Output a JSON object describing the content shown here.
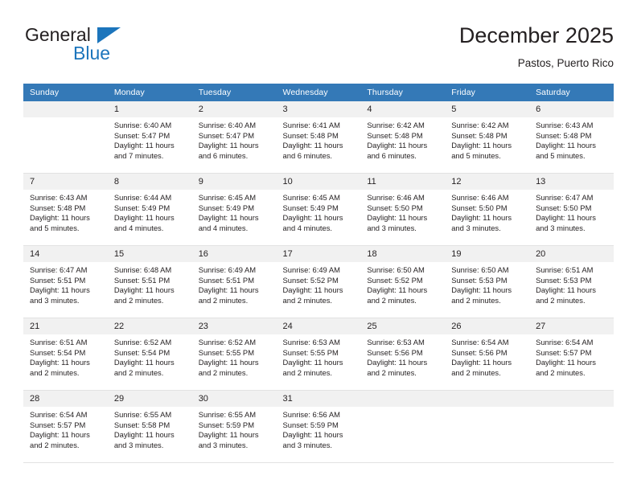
{
  "brand": {
    "name_top": "General",
    "name_bottom": "Blue",
    "accent_color": "#1c75bc"
  },
  "header": {
    "title": "December 2025",
    "subtitle": "Pastos, Puerto Rico"
  },
  "theme": {
    "header_bg": "#3479b7",
    "header_text": "#ffffff",
    "daynum_bg": "#f1f1f1",
    "cell_bg": "#ffffff",
    "grid_line": "#e2e2e2",
    "text": "#231f20"
  },
  "weekday_headers": [
    "Sunday",
    "Monday",
    "Tuesday",
    "Wednesday",
    "Thursday",
    "Friday",
    "Saturday"
  ],
  "weeks": [
    [
      {
        "day": "",
        "lines": []
      },
      {
        "day": "1",
        "lines": [
          "Sunrise: 6:40 AM",
          "Sunset: 5:47 PM",
          "Daylight: 11 hours",
          "and 7 minutes."
        ]
      },
      {
        "day": "2",
        "lines": [
          "Sunrise: 6:40 AM",
          "Sunset: 5:47 PM",
          "Daylight: 11 hours",
          "and 6 minutes."
        ]
      },
      {
        "day": "3",
        "lines": [
          "Sunrise: 6:41 AM",
          "Sunset: 5:48 PM",
          "Daylight: 11 hours",
          "and 6 minutes."
        ]
      },
      {
        "day": "4",
        "lines": [
          "Sunrise: 6:42 AM",
          "Sunset: 5:48 PM",
          "Daylight: 11 hours",
          "and 6 minutes."
        ]
      },
      {
        "day": "5",
        "lines": [
          "Sunrise: 6:42 AM",
          "Sunset: 5:48 PM",
          "Daylight: 11 hours",
          "and 5 minutes."
        ]
      },
      {
        "day": "6",
        "lines": [
          "Sunrise: 6:43 AM",
          "Sunset: 5:48 PM",
          "Daylight: 11 hours",
          "and 5 minutes."
        ]
      }
    ],
    [
      {
        "day": "7",
        "lines": [
          "Sunrise: 6:43 AM",
          "Sunset: 5:48 PM",
          "Daylight: 11 hours",
          "and 5 minutes."
        ]
      },
      {
        "day": "8",
        "lines": [
          "Sunrise: 6:44 AM",
          "Sunset: 5:49 PM",
          "Daylight: 11 hours",
          "and 4 minutes."
        ]
      },
      {
        "day": "9",
        "lines": [
          "Sunrise: 6:45 AM",
          "Sunset: 5:49 PM",
          "Daylight: 11 hours",
          "and 4 minutes."
        ]
      },
      {
        "day": "10",
        "lines": [
          "Sunrise: 6:45 AM",
          "Sunset: 5:49 PM",
          "Daylight: 11 hours",
          "and 4 minutes."
        ]
      },
      {
        "day": "11",
        "lines": [
          "Sunrise: 6:46 AM",
          "Sunset: 5:50 PM",
          "Daylight: 11 hours",
          "and 3 minutes."
        ]
      },
      {
        "day": "12",
        "lines": [
          "Sunrise: 6:46 AM",
          "Sunset: 5:50 PM",
          "Daylight: 11 hours",
          "and 3 minutes."
        ]
      },
      {
        "day": "13",
        "lines": [
          "Sunrise: 6:47 AM",
          "Sunset: 5:50 PM",
          "Daylight: 11 hours",
          "and 3 minutes."
        ]
      }
    ],
    [
      {
        "day": "14",
        "lines": [
          "Sunrise: 6:47 AM",
          "Sunset: 5:51 PM",
          "Daylight: 11 hours",
          "and 3 minutes."
        ]
      },
      {
        "day": "15",
        "lines": [
          "Sunrise: 6:48 AM",
          "Sunset: 5:51 PM",
          "Daylight: 11 hours",
          "and 2 minutes."
        ]
      },
      {
        "day": "16",
        "lines": [
          "Sunrise: 6:49 AM",
          "Sunset: 5:51 PM",
          "Daylight: 11 hours",
          "and 2 minutes."
        ]
      },
      {
        "day": "17",
        "lines": [
          "Sunrise: 6:49 AM",
          "Sunset: 5:52 PM",
          "Daylight: 11 hours",
          "and 2 minutes."
        ]
      },
      {
        "day": "18",
        "lines": [
          "Sunrise: 6:50 AM",
          "Sunset: 5:52 PM",
          "Daylight: 11 hours",
          "and 2 minutes."
        ]
      },
      {
        "day": "19",
        "lines": [
          "Sunrise: 6:50 AM",
          "Sunset: 5:53 PM",
          "Daylight: 11 hours",
          "and 2 minutes."
        ]
      },
      {
        "day": "20",
        "lines": [
          "Sunrise: 6:51 AM",
          "Sunset: 5:53 PM",
          "Daylight: 11 hours",
          "and 2 minutes."
        ]
      }
    ],
    [
      {
        "day": "21",
        "lines": [
          "Sunrise: 6:51 AM",
          "Sunset: 5:54 PM",
          "Daylight: 11 hours",
          "and 2 minutes."
        ]
      },
      {
        "day": "22",
        "lines": [
          "Sunrise: 6:52 AM",
          "Sunset: 5:54 PM",
          "Daylight: 11 hours",
          "and 2 minutes."
        ]
      },
      {
        "day": "23",
        "lines": [
          "Sunrise: 6:52 AM",
          "Sunset: 5:55 PM",
          "Daylight: 11 hours",
          "and 2 minutes."
        ]
      },
      {
        "day": "24",
        "lines": [
          "Sunrise: 6:53 AM",
          "Sunset: 5:55 PM",
          "Daylight: 11 hours",
          "and 2 minutes."
        ]
      },
      {
        "day": "25",
        "lines": [
          "Sunrise: 6:53 AM",
          "Sunset: 5:56 PM",
          "Daylight: 11 hours",
          "and 2 minutes."
        ]
      },
      {
        "day": "26",
        "lines": [
          "Sunrise: 6:54 AM",
          "Sunset: 5:56 PM",
          "Daylight: 11 hours",
          "and 2 minutes."
        ]
      },
      {
        "day": "27",
        "lines": [
          "Sunrise: 6:54 AM",
          "Sunset: 5:57 PM",
          "Daylight: 11 hours",
          "and 2 minutes."
        ]
      }
    ],
    [
      {
        "day": "28",
        "lines": [
          "Sunrise: 6:54 AM",
          "Sunset: 5:57 PM",
          "Daylight: 11 hours",
          "and 2 minutes."
        ]
      },
      {
        "day": "29",
        "lines": [
          "Sunrise: 6:55 AM",
          "Sunset: 5:58 PM",
          "Daylight: 11 hours",
          "and 3 minutes."
        ]
      },
      {
        "day": "30",
        "lines": [
          "Sunrise: 6:55 AM",
          "Sunset: 5:59 PM",
          "Daylight: 11 hours",
          "and 3 minutes."
        ]
      },
      {
        "day": "31",
        "lines": [
          "Sunrise: 6:56 AM",
          "Sunset: 5:59 PM",
          "Daylight: 11 hours",
          "and 3 minutes."
        ]
      },
      {
        "day": "",
        "lines": []
      },
      {
        "day": "",
        "lines": []
      },
      {
        "day": "",
        "lines": []
      }
    ]
  ]
}
